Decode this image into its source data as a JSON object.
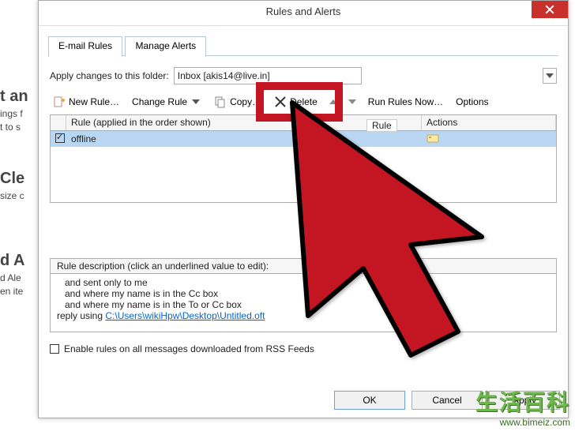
{
  "bg": {
    "line1": "t an",
    "line2": "ings f",
    "line3": "t to s",
    "line4": "Cle",
    "line5": "size c",
    "line6": "d A",
    "line7": "d Ale",
    "line8": "en ite"
  },
  "dialog": {
    "title": "Rules and Alerts",
    "tabs": {
      "email": "E-mail Rules",
      "manage": "Manage Alerts"
    },
    "folder": {
      "label": "Apply changes to this folder:",
      "value": "Inbox [akis14@live.in]"
    },
    "toolbar": {
      "new": "New Rule…",
      "change": "Change Rule",
      "copy": "Copy…",
      "delete": "Delete",
      "run": "Run Rules Now…",
      "options": "Options"
    },
    "list": {
      "header_rule": "Rule (applied in the order shown)",
      "header_actions": "Actions",
      "rows": [
        {
          "name": "offline",
          "checked": true
        }
      ]
    },
    "mid_hint": "Rule",
    "description": {
      "header": "Rule description (click an underlined value to edit):",
      "lines": [
        "and sent only to me",
        "and where my name is in the Cc box",
        "and where my name is in the To or Cc box"
      ],
      "reply_prefix": "reply using ",
      "reply_link": "C:\\Users\\wikiHpw\\Desktop\\Untitled.oft"
    },
    "rss_label": "Enable rules on all messages downloaded from RSS Feeds",
    "buttons": {
      "ok": "OK",
      "cancel": "Cancel",
      "apply": "Apply"
    }
  },
  "watermark": {
    "cn": "生活百科",
    "url": "www.bimeiz.com"
  }
}
